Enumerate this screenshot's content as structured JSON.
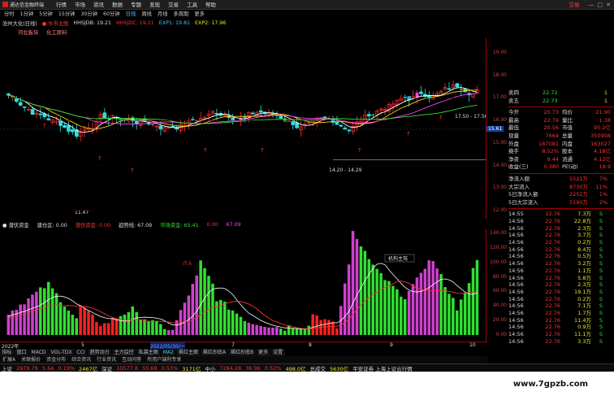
{
  "menubar": {
    "app": "通达信金融终端",
    "items": [
      "行情",
      "市场",
      "资讯",
      "数据",
      "专题",
      "发现",
      "交易",
      "工具",
      "帮助"
    ],
    "trade": "交易",
    "window": [
      "—",
      "□",
      "✕"
    ]
  },
  "periods": [
    "分时",
    "1分钟",
    "5分钟",
    "15分钟",
    "30分钟",
    "60分钟",
    "日线",
    "周线",
    "月线",
    "多周期",
    "更多"
  ],
  "period_selected": "日线",
  "title": {
    "stock": "沧州大化(日线)",
    "mode": "● 牛市主图",
    "hhs": "HHSJDB: 19.21",
    "hhs2": "HHSJDC: 19.21",
    "exp1": "EXP1: 19.81",
    "exp2": "EXP2: 17.96"
  },
  "tags": [
    "河北板块",
    "化工原料"
  ],
  "price_labels": [
    "19.00",
    "18.00",
    "17.00",
    "16.00",
    "15.00",
    "14.00",
    "13.00",
    "12.00"
  ],
  "price_current": "15.61",
  "annot": {
    "range1": "17.50 - 17.56",
    "range2": "14.20 - 14.29",
    "low": "11.47"
  },
  "ind_title": {
    "name": "● 潜伏资金",
    "hold": "建仓区: 0.00",
    "lurk": "潜伏资金: 0.00",
    "trend": "趋势线: 67.09",
    "market": "市场资金: 65.41",
    "zero": "0.00",
    "v": "67.09"
  },
  "ind_labels": [
    "140.00",
    "120.00",
    "100.00",
    "80.00",
    "60.00",
    "40.00",
    "20.00",
    "0.00"
  ],
  "ind_annot": "机构主驾",
  "ind_mark": "介入",
  "dates": [
    "2022年",
    "5",
    "2022/05/30/一",
    "7",
    "8",
    "9",
    "10"
  ],
  "tabs": [
    "指标",
    "窗口",
    "MACD",
    "VOL-TDX",
    "CCI",
    "趋势动力",
    "主力监控",
    "私募主图",
    "MA2",
    "飙红主图",
    "飙红抄底A",
    "飙红抄底B",
    "更多",
    "设置"
  ],
  "tab_selected": "MA2",
  "bottom": [
    "扩展A",
    "关联报价",
    "资金分布",
    "综合资讯",
    "行业资讯",
    "互动问答",
    "所用户端利专享"
  ],
  "order_book": [
    {
      "label": "卖四",
      "price": "22.72",
      "vol": "1"
    },
    {
      "label": "卖五",
      "price": "22.73",
      "vol": "1"
    }
  ],
  "quote": [
    [
      "今开",
      "20.73",
      "均价",
      "21.90"
    ],
    [
      "最高",
      "22.76",
      "量比",
      "1.38"
    ],
    [
      "最低",
      "20.56",
      "市值",
      "95.2亿"
    ],
    [
      "现量",
      "7664",
      "总量",
      "350908"
    ],
    [
      "外盘",
      "187081",
      "内盘",
      "163027"
    ],
    [
      "换手",
      "8.52%",
      "股本",
      "4.18亿"
    ],
    [
      "净资",
      "9.44",
      "流通",
      "4.12亿"
    ],
    [
      "收益(三)",
      "0.380",
      "PE(动)",
      "19.9"
    ]
  ],
  "flow": [
    {
      "label": "净流入额",
      "val": "5521万",
      "pct": "7%"
    },
    {
      "label": "大宗流入",
      "val": "8730万",
      "pct": "11%"
    },
    {
      "label": "5日净流入额",
      "val": "2252万",
      "pct": "1%"
    },
    {
      "label": "5日大宗流入",
      "val": "5190万",
      "pct": "2%"
    }
  ],
  "ticks": [
    [
      "14:55",
      "22.76",
      "7.3万",
      "S"
    ],
    [
      "14:56",
      "22.76",
      "22.8万",
      "S"
    ],
    [
      "14:56",
      "22.76",
      "2.3万",
      "S"
    ],
    [
      "14:56",
      "22.76",
      "3.7万",
      "S"
    ],
    [
      "14:56",
      "22.76",
      "0.2万",
      "S"
    ],
    [
      "14:56",
      "22.76",
      "8.4万",
      "S"
    ],
    [
      "14:56",
      "22.76",
      "0.5万",
      "S"
    ],
    [
      "14:56",
      "22.76",
      "3.2万",
      "S"
    ],
    [
      "14:56",
      "22.76",
      "1.1万",
      "S"
    ],
    [
      "14:56",
      "22.76",
      "5.8万",
      "S"
    ],
    [
      "14:56",
      "22.76",
      "2.3万",
      "S"
    ],
    [
      "14:56",
      "22.76",
      "19.1万",
      "S"
    ],
    [
      "14:56",
      "22.76",
      "0.2万",
      "S"
    ],
    [
      "14:56",
      "22.76",
      "7.1万",
      "S"
    ],
    [
      "14:56",
      "22.76",
      "1.7万",
      "S"
    ],
    [
      "14:56",
      "22.76",
      "11.4万",
      "S"
    ],
    [
      "14:56",
      "22.76",
      "0.9万",
      "S"
    ],
    [
      "14:56",
      "22.76",
      "11.1万",
      "S"
    ],
    [
      "14:56",
      "22.76",
      "3.3万",
      "S"
    ]
  ],
  "status": {
    "sh": "上证",
    "sh_v": "2979.79",
    "sh_c": "5.64",
    "sh_p": "0.19%",
    "sh_a": "2467亿",
    "sz": "深证",
    "sz_v": "10577.8",
    "sz_c": "55.69",
    "sz_p": "0.53%",
    "sz_a": "3171亿",
    "zx": "中小",
    "zx_v": "7284.28",
    "zx_c": "36.96",
    "zx_p": "0.52%",
    "zx_a": "498.0亿",
    "total": "总成交",
    "total_v": "5630亿",
    "broker": "平安证券 上海上证云行情"
  },
  "watermark": "www.7gpzb.com"
}
